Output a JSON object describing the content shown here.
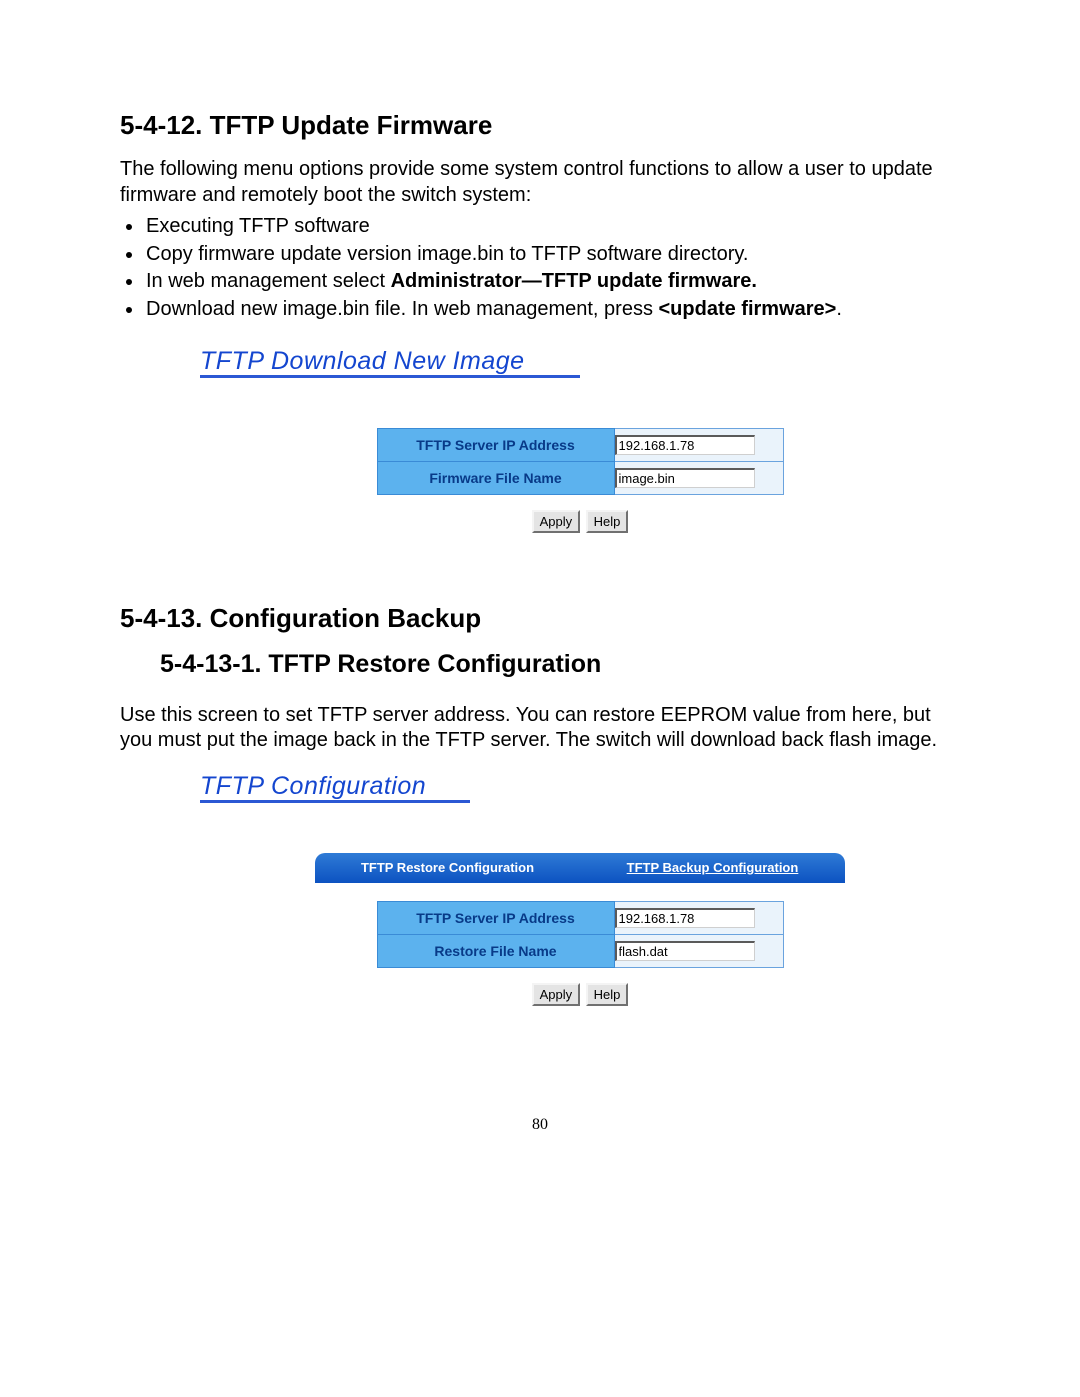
{
  "section1": {
    "heading": "5-4-12. TFTP Update Firmware",
    "intro": "The following menu options provide some system control functions to allow a user to update firmware and remotely boot the switch system:",
    "bullets": {
      "b1": "Executing TFTP software",
      "b2": "Copy firmware update version image.bin to TFTP software directory.",
      "b3_pre": "In web management select ",
      "b3_strong": "Administrator—TFTP update firmware.",
      "b4_pre": "Download new image.bin file.  In web management, press ",
      "b4_strong1": "<update firmware>",
      "b4_post": "."
    },
    "web_title": "TFTP Download New Image",
    "form": {
      "row1_label": "TFTP Server IP Address",
      "row1_value": "192.168.1.78",
      "row2_label": "Firmware File Name",
      "row2_value": "image.bin"
    },
    "buttons": {
      "apply": "Apply",
      "help": "Help"
    }
  },
  "section2": {
    "heading": "5-4-13. Configuration Backup",
    "subheading": "5-4-13-1. TFTP Restore Configuration",
    "body": "Use this screen to set TFTP server address. You can restore EEPROM value from here, but you must put the image back in the TFTP server.  The switch will download back flash image.",
    "web_title": "TFTP Configuration",
    "tabs": {
      "left": "TFTP Restore Configuration",
      "right": "TFTP Backup Configuration"
    },
    "form": {
      "row1_label": "TFTP Server IP Address",
      "row1_value": "192.168.1.78",
      "row2_label": "Restore File Name",
      "row2_value": "flash.dat"
    },
    "buttons": {
      "apply": "Apply",
      "help": "Help"
    }
  },
  "page_number": "80"
}
